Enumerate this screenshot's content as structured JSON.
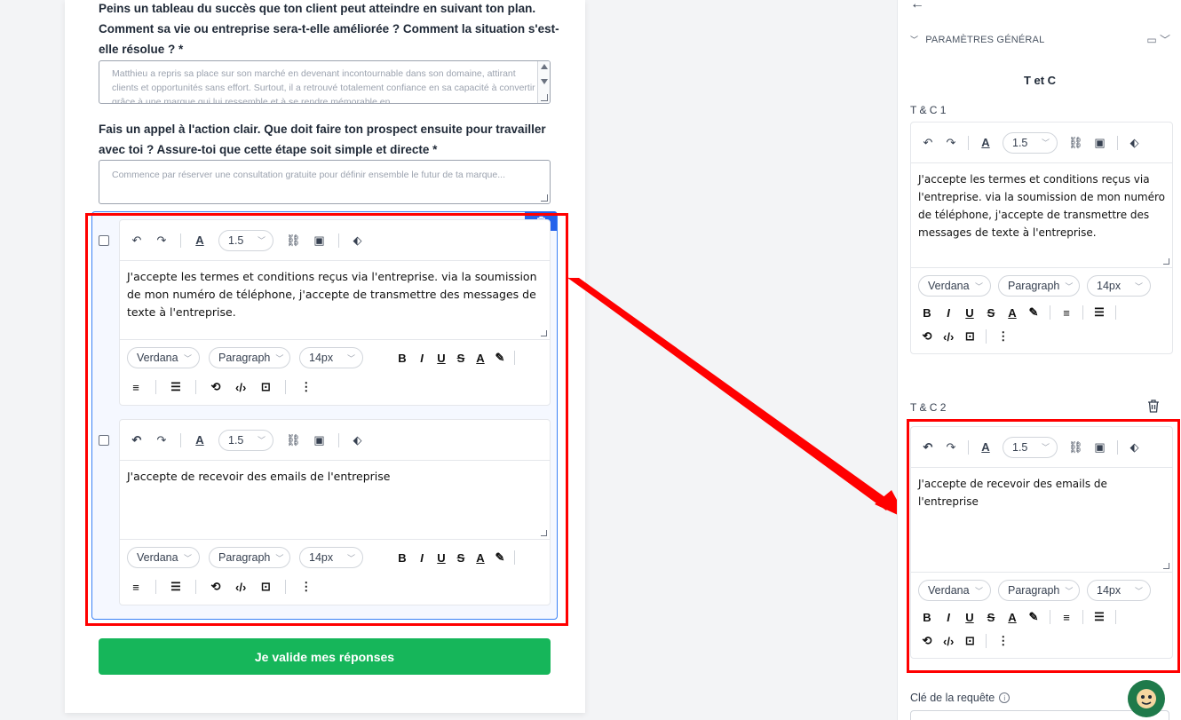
{
  "form": {
    "question1": "Peins un tableau du succès que ton client peut atteindre en suivant ton plan. Comment sa vie ou entreprise sera-t-elle améliorée ? Comment la situation s'est-elle résolue ? *",
    "answer1_placeholder": "Matthieu a repris sa place sur son marché en devenant incontournable dans son domaine, attirant clients et opportunités sans effort. Surtout, il a retrouvé totalement confiance en sa capacité à convertir grâce à une marque qui lui ressemble et à se rendre mémorable en",
    "question2": "Fais un appel à l'action clair. Que doit faire ton prospect ensuite pour travailler avec toi ? Assure-toi que cette étape soit simple et directe *",
    "answer2_placeholder": "Commence par réserver une consultation gratuite pour définir ensemble le futur de ta marque...",
    "submit_label": "Je valide mes réponses"
  },
  "editor_common": {
    "line_height": "1.5",
    "font": "Verdana",
    "block": "Paragraph",
    "size": "14px"
  },
  "editors": {
    "tc1_text": "J'accepte les termes et conditions reçus via l'entreprise. via la soumission de mon numéro de téléphone, j'accepte de transmettre des messages de texte à l'entreprise.",
    "tc2_text": "J'accepte de recevoir des emails de l'entreprise"
  },
  "panel": {
    "section": "PARAMÈTRES GÉNÉRAL",
    "title": "T et C",
    "tc1_label": "T & C 1",
    "tc2_label": "T & C 2",
    "request_key_label": "Clé de la requête"
  },
  "icons": {
    "undo": "undo-icon",
    "redo": "redo-icon",
    "text_color": "text-color-icon",
    "link": "link-icon",
    "image": "image-icon",
    "tag": "tag-icon",
    "trash": "trash-icon"
  },
  "colors": {
    "primary": "#2563eb",
    "submit": "#16b65a",
    "highlight": "#ff0000"
  }
}
